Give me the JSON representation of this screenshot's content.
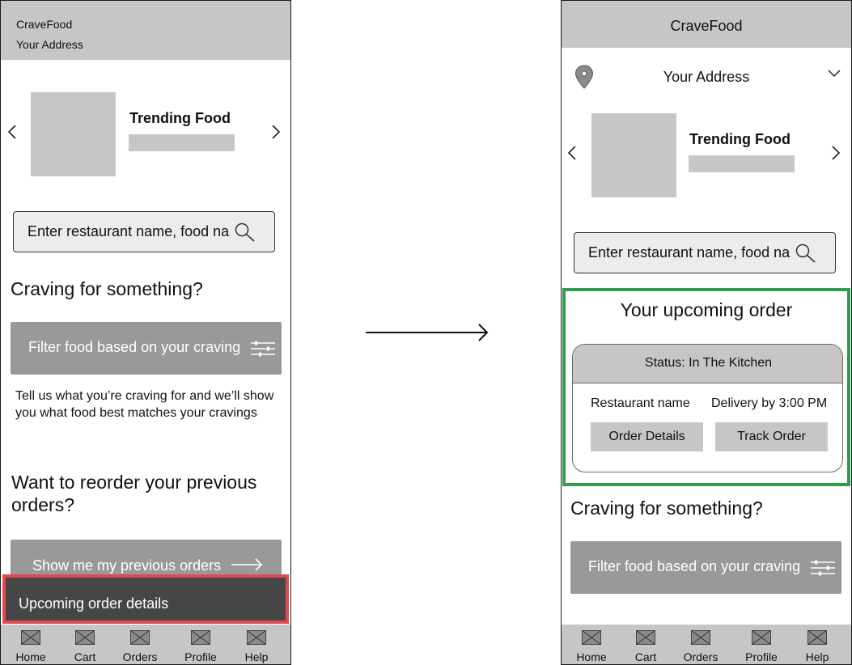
{
  "left_screen": {
    "app_name": "CraveFood",
    "address": "Your Address",
    "trending_title": "Trending Food",
    "search_placeholder": "Enter restaurant name, food name",
    "craving_heading": "Craving for something?",
    "filter_button": "Filter food based on your craving",
    "craving_description": "Tell us what you’re craving for and we’ll show you what food best matches your cravings",
    "reorder_heading": "Want to reorder your previous orders?",
    "previous_orders_button": "Show me my previous orders",
    "upcoming_toast": "Upcoming order details"
  },
  "right_screen": {
    "app_name": "CraveFood",
    "address": "Your Address",
    "trending_title": "Trending Food",
    "search_placeholder": "Enter restaurant name, food name",
    "upcoming": {
      "title": "Your upcoming order",
      "status": "Status: In The Kitchen",
      "restaurant": "Restaurant name",
      "delivery": "Delivery by 3:00 PM",
      "order_details_button": "Order Details",
      "track_order_button": "Track Order"
    },
    "craving_heading": "Craving for something?",
    "filter_button": "Filter food based on your craving"
  },
  "bottom_nav": [
    "Home",
    "Cart",
    "Orders",
    "Profile",
    "Help"
  ],
  "icons": {
    "nav": "image-placeholder-icon",
    "search": "magnifier-icon",
    "filter": "sliders-icon",
    "location": "map-pin-icon",
    "transition": "right-arrow-icon"
  },
  "colors": {
    "header_grey": "#c6c6c6",
    "button_grey": "#999999",
    "toast_dark": "#464646",
    "highlight_red": "#e04a4f",
    "highlight_green": "#2e9e4e"
  }
}
